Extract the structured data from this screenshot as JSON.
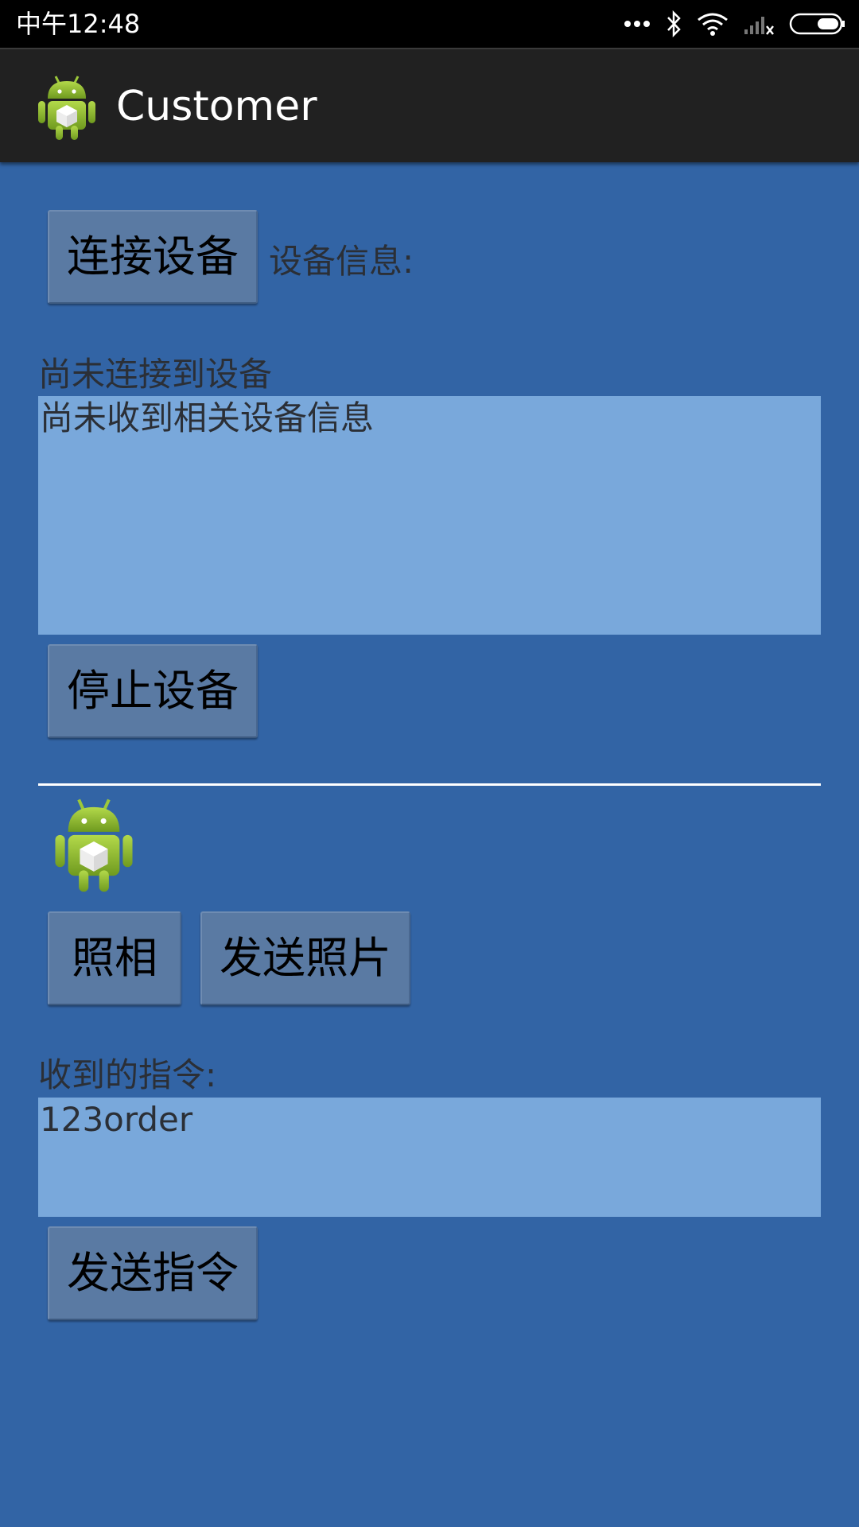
{
  "status_bar": {
    "time": "中午12:48",
    "icons": [
      "more-dots-icon",
      "bluetooth-icon",
      "wifi-icon",
      "signal-no-service-icon",
      "battery-icon"
    ]
  },
  "action_bar": {
    "title": "Customer",
    "icon": "android-app-icon"
  },
  "device_section": {
    "connect_button": "连接设备",
    "device_info_label": "设备信息:",
    "connection_status": "尚未连接到设备",
    "device_info_text": "尚未收到相关设备信息",
    "stop_button": "停止设备"
  },
  "photo_section": {
    "preview_icon": "android-image-icon",
    "take_photo_button": "照相",
    "send_photo_button": "发送照片"
  },
  "command_section": {
    "received_label": "收到的指令:",
    "received_text": "123order",
    "send_command_button": "发送指令"
  },
  "colors": {
    "background": "#3264a5",
    "textbox": "#79a8db",
    "button": "#5a7aa3",
    "action_bar": "#212121",
    "status_bar": "#000000"
  }
}
